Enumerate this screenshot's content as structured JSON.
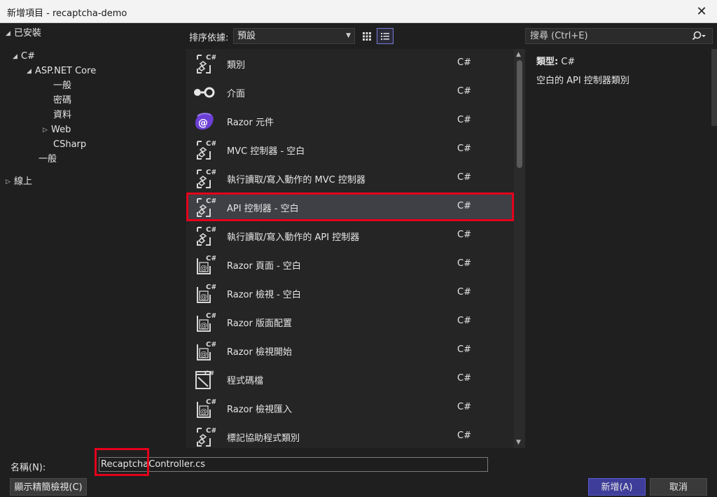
{
  "window": {
    "title": "新增項目 - recaptcha-demo",
    "close_glyph": "✕"
  },
  "tree": {
    "installed": "已安裝",
    "csharp": "C#",
    "aspnet": "ASP.NET Core",
    "general": "一般",
    "code": "密碼",
    "data": "資料",
    "web": "Web",
    "csharp_sub": "CSharp",
    "general2": "一般",
    "online": "線上"
  },
  "toolbar": {
    "sort_label": "排序依據:",
    "sort_value": "預設",
    "search_placeholder": "搜尋 (Ctrl+E)"
  },
  "templates": [
    {
      "name": "類別",
      "lang": "C#",
      "icon": "cs-class-icon"
    },
    {
      "name": "介面",
      "lang": "C#",
      "icon": "interface-icon"
    },
    {
      "name": "Razor 元件",
      "lang": "C#",
      "icon": "razor-component-icon"
    },
    {
      "name": "MVC 控制器 - 空白",
      "lang": "C#",
      "icon": "cs-class-icon"
    },
    {
      "name": "執行讀取/寫入動作的 MVC 控制器",
      "lang": "C#",
      "icon": "cs-class-icon"
    },
    {
      "name": "API 控制器 - 空白",
      "lang": "C#",
      "icon": "cs-class-icon",
      "selected": true
    },
    {
      "name": "執行讀取/寫入動作的 API 控制器",
      "lang": "C#",
      "icon": "cs-class-icon"
    },
    {
      "name": "Razor 頁面 - 空白",
      "lang": "C#",
      "icon": "razor-page-icon"
    },
    {
      "name": "Razor 檢視 - 空白",
      "lang": "C#",
      "icon": "razor-page-icon"
    },
    {
      "name": "Razor 版面配置",
      "lang": "C#",
      "icon": "razor-page-icon"
    },
    {
      "name": "Razor 檢視開始",
      "lang": "C#",
      "icon": "razor-page-icon"
    },
    {
      "name": "程式碼檔",
      "lang": "C#",
      "icon": "code-file-icon"
    },
    {
      "name": "Razor 檢視匯入",
      "lang": "C#",
      "icon": "razor-page-icon"
    },
    {
      "name": "標記協助程式類別",
      "lang": "C#",
      "icon": "cs-class-icon"
    }
  ],
  "details": {
    "type_label": "類型:",
    "type_value": "C#",
    "description": "空白的 API 控制器類別"
  },
  "footer": {
    "name_label": "名稱(N):",
    "name_value": "RecaptchaController.cs",
    "compact_button": "顯示精簡檢視(C)",
    "add_button": "新增(A)",
    "cancel_button": "取消"
  },
  "colors": {
    "accent": "#e3001b",
    "primary_button": "#3e3e9a",
    "razor_purple": "#6b3fd6"
  }
}
